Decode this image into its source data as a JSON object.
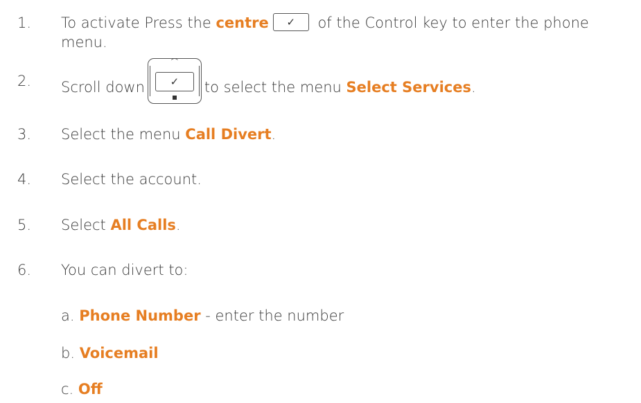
{
  "steps": [
    {
      "num": "1.",
      "pre": "To activate Press the ",
      "hl1": "centre",
      "mid": " of the Control key to enter the phone",
      "line2": "menu."
    },
    {
      "num": "2.",
      "pre": "Scroll down",
      "post": "to select the menu ",
      "hl": "Select Services",
      "end": "."
    },
    {
      "num": "3.",
      "pre": "Select the menu ",
      "hl": "Call Divert",
      "end": "."
    },
    {
      "num": "4.",
      "text": "Select the account."
    },
    {
      "num": "5.",
      "pre": "Select ",
      "hl": "All Calls",
      "end": "."
    },
    {
      "num": "6.",
      "text": "You can divert to:"
    }
  ],
  "options": [
    {
      "prefix": "a. ",
      "hl": "Phone Number",
      "rest": " - enter the number"
    },
    {
      "prefix": "b. ",
      "hl": "Voicemail",
      "rest": ""
    },
    {
      "prefix": "c. ",
      "hl": "Off",
      "rest": ""
    }
  ],
  "icons": {
    "check": "✓"
  },
  "colors": {
    "highlight": "#e67e22",
    "text": "#3a3a3a"
  }
}
